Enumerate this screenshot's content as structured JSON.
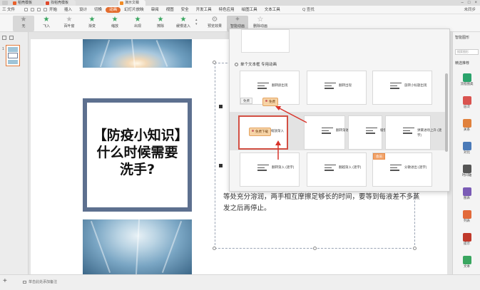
{
  "tabs": {
    "templates": "稻壳模板",
    "docs": "找稻壳模板",
    "active": "演示文稿"
  },
  "menu": {
    "file": "三 文件",
    "items": [
      "开始",
      "插入",
      "设计",
      "切换",
      "动画",
      "幻灯片放映",
      "审阅",
      "视图",
      "安全",
      "开发工具",
      "特色应用",
      "绘图工具",
      "文本工具"
    ],
    "active_index": 4,
    "search": "Q 查找",
    "right": "未同步"
  },
  "ribbon": {
    "buttons": [
      {
        "label": "无",
        "icon": "gray"
      },
      {
        "label": "飞入",
        "icon": "green"
      },
      {
        "label": "百叶窗",
        "icon": "light"
      },
      {
        "label": "渐变",
        "icon": "green"
      },
      {
        "label": "缩放",
        "icon": "green"
      },
      {
        "label": "出现",
        "icon": "green"
      },
      {
        "label": "擦除",
        "icon": "green"
      },
      {
        "label": "缓慢进入",
        "icon": "green"
      }
    ],
    "right_buttons": [
      "预览效果",
      "智能动画",
      "删除动画"
    ]
  },
  "left_panel": {
    "slide_number": "1"
  },
  "slide": {
    "title": "【防疫小知识】什么时候需要洗手?",
    "body": "等处充分溶润，两手相互摩擦足够长的时间，要等到每液差不多蒸发之后再停止。"
  },
  "anim_panel": {
    "section_title": "单个文本框 专用动画",
    "cards": [
      {
        "title": "翻转颜出现",
        "tag": "免费",
        "orange": false
      },
      {
        "title": "翻转出现",
        "tag": "",
        "orange": false
      },
      {
        "title": "旋转小标题出现",
        "tag": "",
        "orange": false
      },
      {
        "title": "缩放渐入",
        "tag": "",
        "orange": false
      },
      {
        "title": "翻转渐进入",
        "tag": "",
        "orange": false
      },
      {
        "title": "缓慢上升",
        "tag": "",
        "orange": false
      },
      {
        "title": "弹簧进场上升 (逐字)",
        "tag": "",
        "orange": false
      },
      {
        "title": "翻转渐入 (逐字)",
        "tag": "",
        "orange": false
      },
      {
        "title": "翻越渐入 (逐字)",
        "tag": "",
        "orange": false
      },
      {
        "title": "分散进出 (逐字)",
        "tag": "会员",
        "orange": true
      }
    ],
    "free_button_1": "免费",
    "free_button_2": "免费下载",
    "hover_label": "缩放渐入"
  },
  "right_panel": {
    "title": "智能图形",
    "search_placeholder": "搜索图形",
    "recommend": "精选推荐",
    "items": [
      {
        "label": "流程图类",
        "color": "#2aa36b"
      },
      {
        "label": "层次",
        "color": "#d9534f"
      },
      {
        "label": "关系",
        "color": "#e0813c"
      },
      {
        "label": "对比",
        "color": "#4a7ab8"
      },
      {
        "label": "时间轴",
        "color": "#555555"
      },
      {
        "label": "图表",
        "color": "#7a5bb5"
      },
      {
        "label": "列表",
        "color": "#e26a3a"
      },
      {
        "label": "提示",
        "color": "#c0392b"
      },
      {
        "label": "文本",
        "color": "#3aa660"
      }
    ]
  },
  "statusbar": {
    "note": "单击此处添加备注"
  }
}
